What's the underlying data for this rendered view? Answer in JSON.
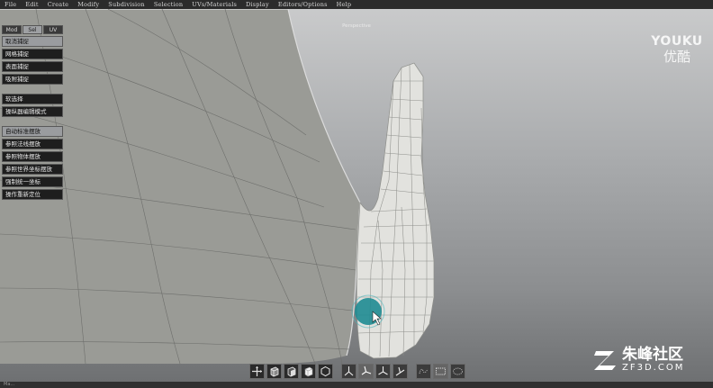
{
  "menu": [
    "File",
    "Edit",
    "Create",
    "Modify",
    "Subdivision",
    "Selection",
    "UVs/Materials",
    "Display",
    "Editors/Options",
    "Help"
  ],
  "viewport_label": "Perspective",
  "tabs": [
    {
      "label": "Mod",
      "active": false
    },
    {
      "label": "Sel",
      "active": true
    },
    {
      "label": "UV",
      "active": false
    }
  ],
  "panel_group1": [
    {
      "label": "取消捕捉",
      "highlight": true
    },
    {
      "label": "网格捕捉",
      "highlight": false
    },
    {
      "label": "表面捕捉",
      "highlight": false
    },
    {
      "label": "吸附捕捉",
      "highlight": false
    }
  ],
  "panel_group2": [
    {
      "label": "软选择",
      "highlight": false
    },
    {
      "label": "操纵器编辑模式",
      "highlight": false
    }
  ],
  "panel_group3": [
    {
      "label": "自动标准摆放",
      "highlight": true
    },
    {
      "label": "参照法线摆放",
      "highlight": false
    },
    {
      "label": "参照物体摆放",
      "highlight": false
    },
    {
      "label": "参照世界坐标摆放",
      "highlight": false
    },
    {
      "label": "强制统一坐标",
      "highlight": false
    },
    {
      "label": "操作重新定位",
      "highlight": false
    }
  ],
  "toolbar_icons": [
    "move-tool-icon",
    "cube-face-icon",
    "cube-edge-icon",
    "cube-solid-icon",
    "hexagon-icon",
    "axis-world-icon",
    "axis-local-icon",
    "axis-normal-icon",
    "axis-screen-icon",
    "lasso-select-icon",
    "rect-select-icon",
    "paint-select-icon"
  ],
  "watermark_youku": {
    "line1": "YOUKU",
    "line2": "优酷"
  },
  "watermark_zf": {
    "line1": "朱峰社区",
    "line2": "ZF3D.COM"
  },
  "status_text": "Ma..."
}
